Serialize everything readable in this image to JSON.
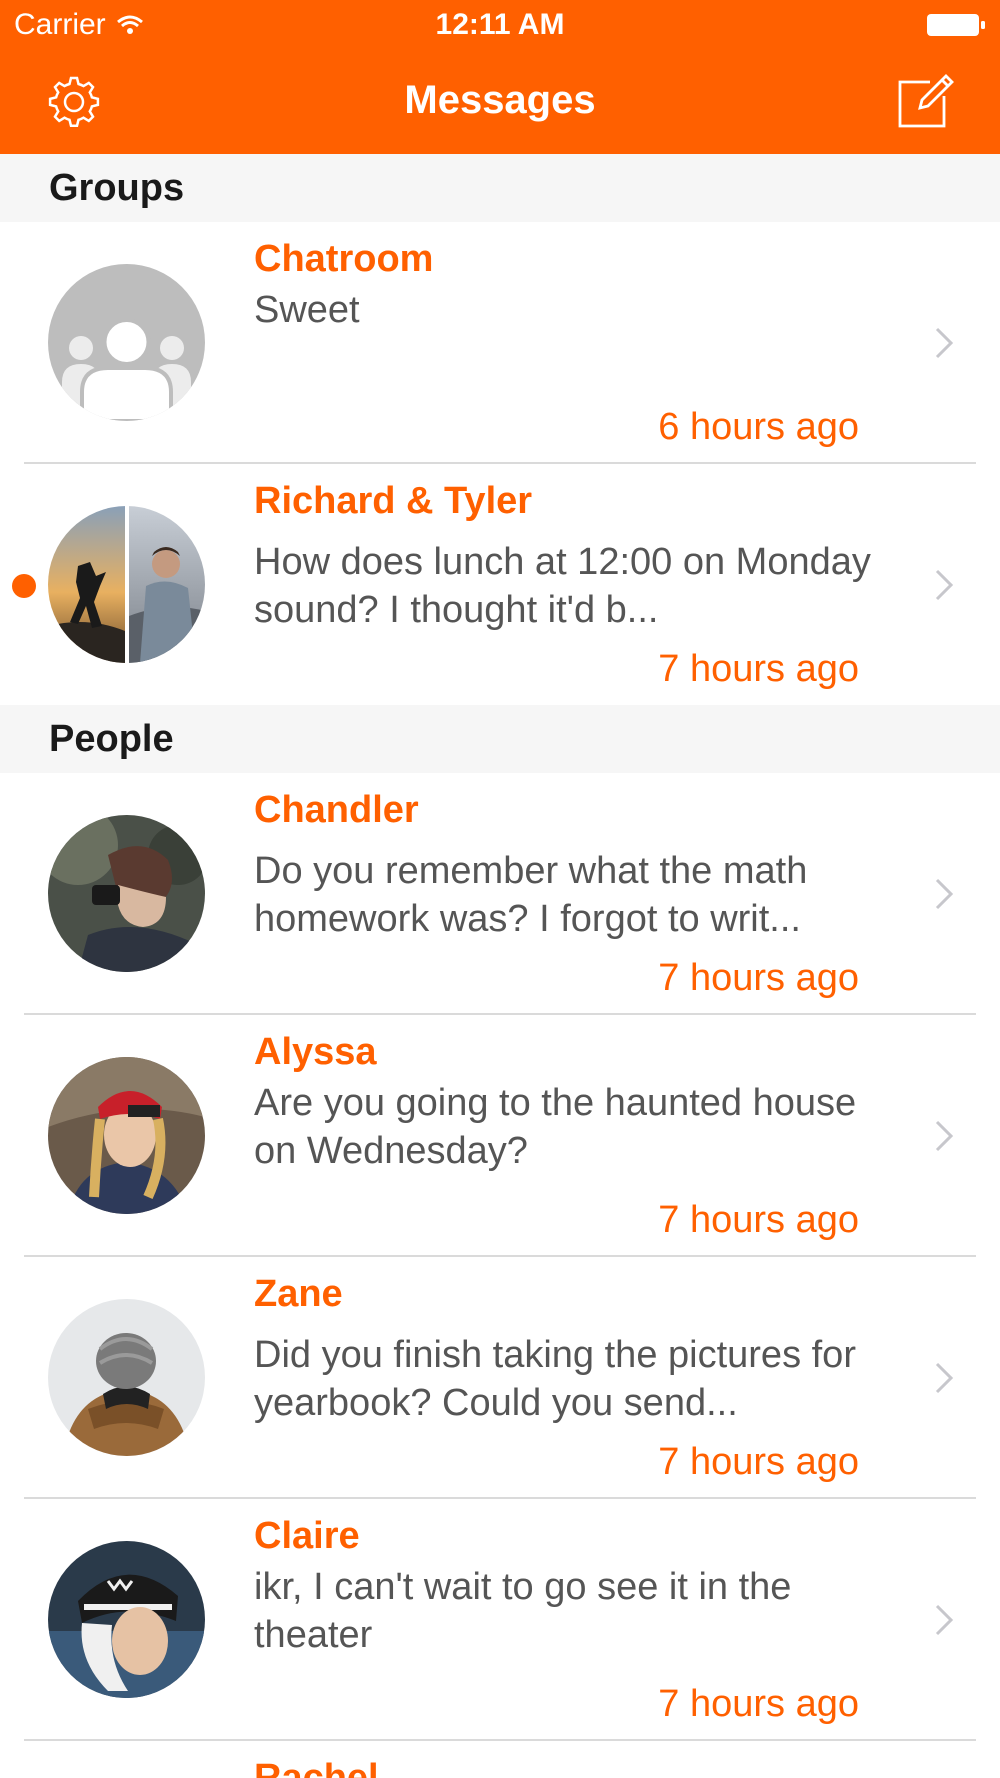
{
  "status_bar": {
    "carrier": "Carrier",
    "time": "12:11 AM"
  },
  "nav": {
    "title": "Messages",
    "left_icon": "gear-icon",
    "right_icon": "compose-icon"
  },
  "colors": {
    "accent": "#FF6000",
    "section_bg": "#f6f6f6",
    "preview_text": "#555555"
  },
  "sections": [
    {
      "title": "Groups"
    },
    {
      "title": "People"
    }
  ],
  "conversations": [
    {
      "name": "Chatroom",
      "preview": "Sweet",
      "time": "6 hours ago",
      "unread": false
    },
    {
      "name": "Richard & Tyler",
      "preview": "How does lunch at 12:00 on Monday sound? I thought it'd b...",
      "time": "7 hours ago",
      "unread": true
    },
    {
      "name": "Chandler",
      "preview": "Do you remember what the math homework was? I forgot to writ...",
      "time": "7 hours ago",
      "unread": false
    },
    {
      "name": "Alyssa",
      "preview": "Are you going to the haunted house on Wednesday?",
      "time": "7 hours ago",
      "unread": false
    },
    {
      "name": "Zane",
      "preview": "Did you finish taking the pictures for yearbook? Could you send...",
      "time": "7 hours ago",
      "unread": false
    },
    {
      "name": "Claire",
      "preview": "ikr, I can't wait to go see it in the theater",
      "time": "7 hours ago",
      "unread": false
    },
    {
      "name": "Rachel",
      "preview": "",
      "time": "",
      "unread": false
    }
  ]
}
